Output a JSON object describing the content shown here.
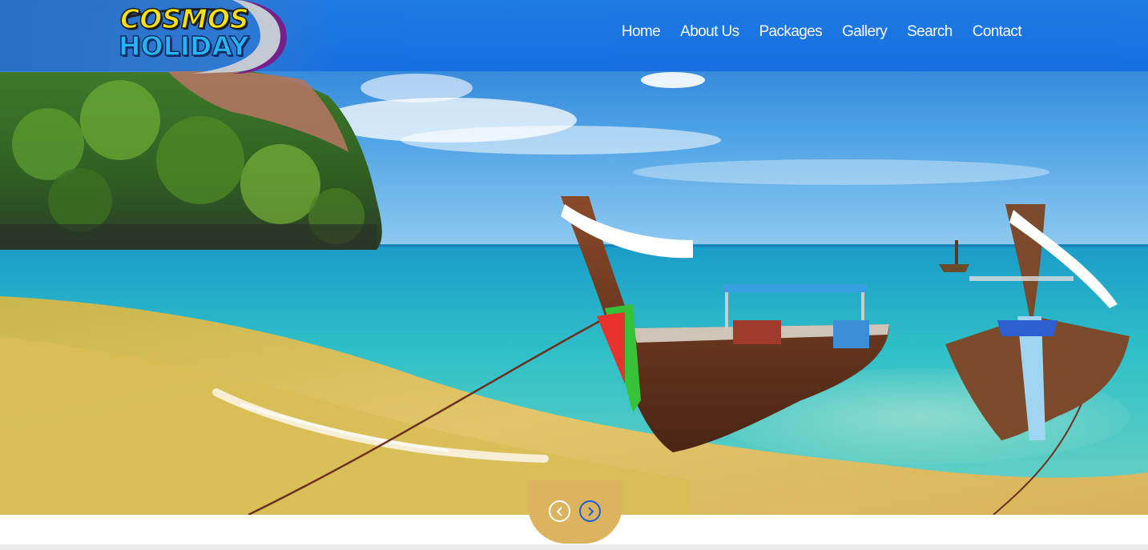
{
  "brand": {
    "logo_line1": "COSMOS",
    "logo_line2": "HOLIDAY",
    "logo_colors": {
      "line1": "#ffe600",
      "line2": "#29b6f6"
    }
  },
  "header": {
    "background": "#1f7be6"
  },
  "nav": {
    "items": [
      {
        "label": "Home"
      },
      {
        "label": "About Us"
      },
      {
        "label": "Packages"
      },
      {
        "label": "Gallery"
      },
      {
        "label": "Search"
      },
      {
        "label": "Contact"
      }
    ]
  },
  "slider": {
    "prev_icon": "chevron-left-icon",
    "next_icon": "chevron-right-icon",
    "tab_color": "#dcb35f",
    "active_arrow_color": "#1a5fd6"
  }
}
